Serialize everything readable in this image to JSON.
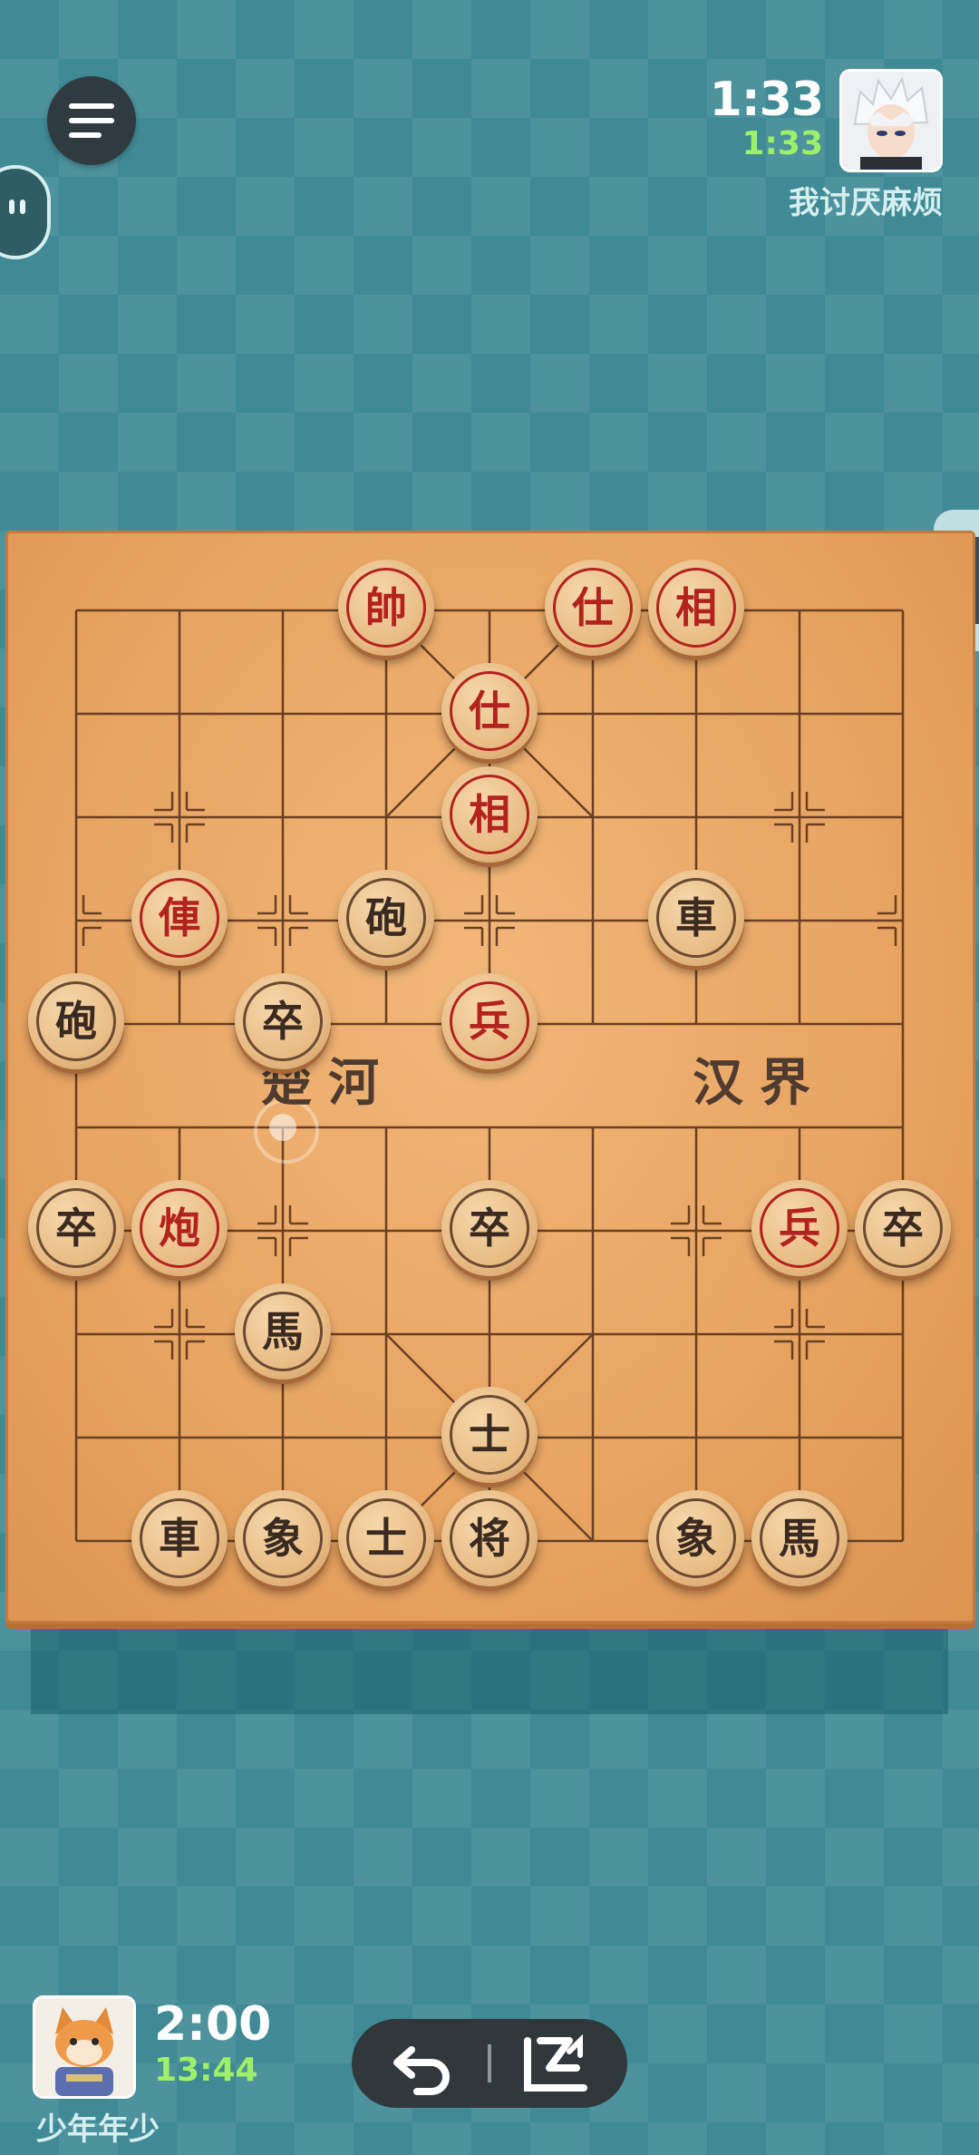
{
  "opponent": {
    "main_time": "1:33",
    "sub_time": "1:33",
    "name": "我讨厌麻烦"
  },
  "player": {
    "main_time": "2:00",
    "sub_time": "13:44",
    "name": "少年年少"
  },
  "board": {
    "river_left": "楚河",
    "river_right": "汉界",
    "pieces": [
      {
        "label": "帥",
        "side": "red",
        "file": 3,
        "rank": 0
      },
      {
        "label": "仕",
        "side": "red",
        "file": 5,
        "rank": 0
      },
      {
        "label": "相",
        "side": "red",
        "file": 6,
        "rank": 0
      },
      {
        "label": "仕",
        "side": "red",
        "file": 4,
        "rank": 1
      },
      {
        "label": "相",
        "side": "red",
        "file": 4,
        "rank": 2
      },
      {
        "label": "俥",
        "side": "red",
        "file": 1,
        "rank": 3
      },
      {
        "label": "砲",
        "side": "black",
        "file": 3,
        "rank": 3
      },
      {
        "label": "車",
        "side": "black",
        "file": 6,
        "rank": 3
      },
      {
        "label": "砲",
        "side": "black",
        "file": 0,
        "rank": 4
      },
      {
        "label": "卒",
        "side": "black",
        "file": 2,
        "rank": 4
      },
      {
        "label": "兵",
        "side": "red",
        "file": 4,
        "rank": 4
      },
      {
        "label": "卒",
        "side": "black",
        "file": 0,
        "rank": 6
      },
      {
        "label": "炮",
        "side": "red",
        "file": 1,
        "rank": 6
      },
      {
        "label": "卒",
        "side": "black",
        "file": 4,
        "rank": 6
      },
      {
        "label": "兵",
        "side": "red",
        "file": 7,
        "rank": 6
      },
      {
        "label": "卒",
        "side": "black",
        "file": 8,
        "rank": 6
      },
      {
        "label": "馬",
        "side": "black",
        "file": 2,
        "rank": 7
      },
      {
        "label": "士",
        "side": "black",
        "file": 4,
        "rank": 8
      },
      {
        "label": "車",
        "side": "black",
        "file": 1,
        "rank": 9
      },
      {
        "label": "象",
        "side": "black",
        "file": 2,
        "rank": 9
      },
      {
        "label": "士",
        "side": "black",
        "file": 3,
        "rank": 9
      },
      {
        "label": "将",
        "side": "black",
        "file": 4,
        "rank": 9
      },
      {
        "label": "象",
        "side": "black",
        "file": 6,
        "rank": 9
      },
      {
        "label": "馬",
        "side": "black",
        "file": 7,
        "rank": 9
      }
    ],
    "last_move": {
      "from": {
        "file": 2,
        "rank": 5
      },
      "to": {
        "file": 2,
        "rank": 4
      }
    }
  },
  "icons": {
    "menu": "menu-icon",
    "chat": "chat-bubble-icon",
    "undo": "undo-arrow-icon",
    "resign": "resign-flag-icon"
  },
  "colors": {
    "red_piece_text": "#b3231e",
    "black_piece_text": "#3a2a20",
    "timer_accent": "#9ef06a"
  }
}
